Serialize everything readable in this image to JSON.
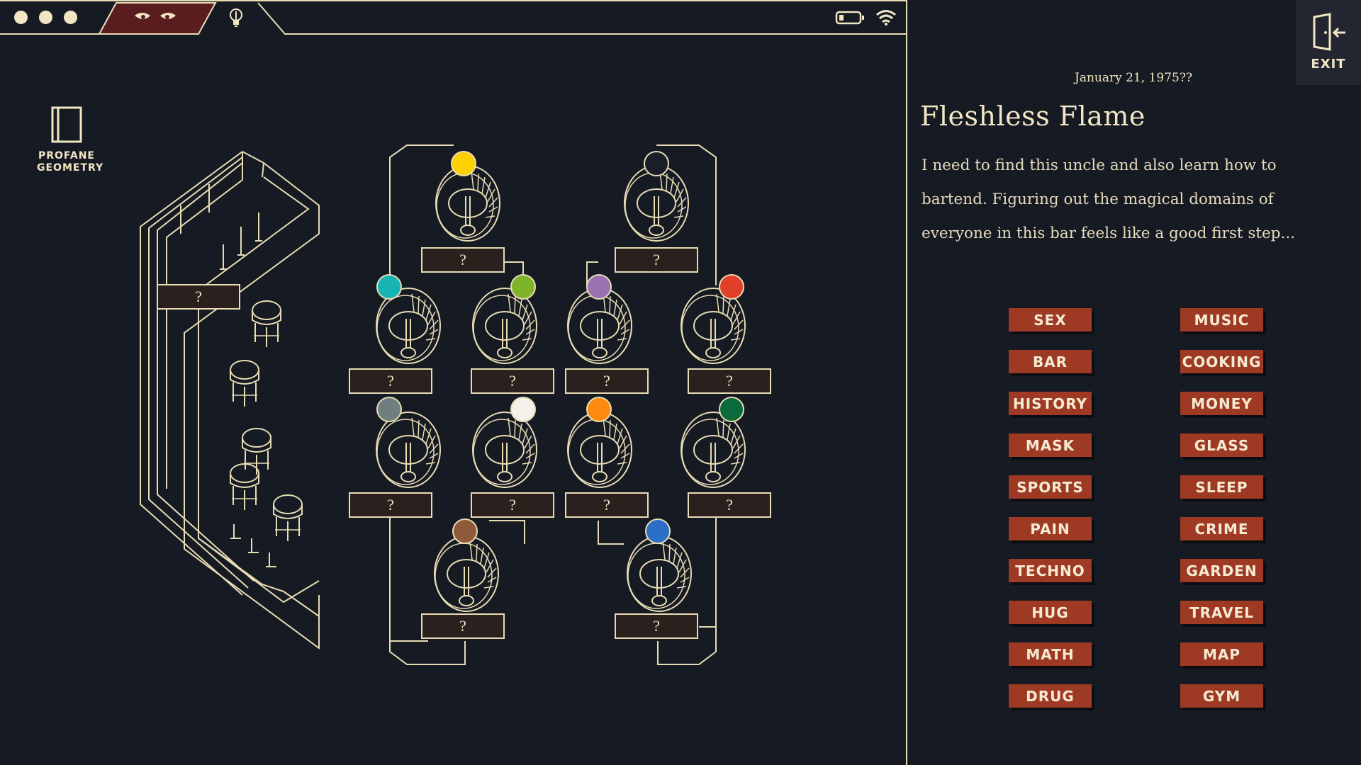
{
  "topbar": {
    "dot_icons": [
      "dot-icon",
      "dot-icon",
      "dot-icon"
    ],
    "eyes_icon": "eyes-icon",
    "hint_icon": "lightbulb-icon",
    "battery_icon": "battery-icon",
    "wifi_icon": "wifi-icon"
  },
  "book": {
    "icon": "book-icon",
    "label_line1": "PROFANE",
    "label_line2": "GEOMETRY"
  },
  "bar_slot": {
    "label": "?"
  },
  "staircases": [
    {
      "orb_color": "#ffd000",
      "slot_label": "?"
    },
    {
      "orb_color": "#1a1e28",
      "slot_label": "?"
    },
    {
      "orb_color": "#17b4b4",
      "slot_label": "?"
    },
    {
      "orb_color": "#7fb42a",
      "slot_label": "?"
    },
    {
      "orb_color": "#9a72b4",
      "slot_label": "?"
    },
    {
      "orb_color": "#e0402a",
      "slot_label": "?"
    },
    {
      "orb_color": "#6f7f80",
      "slot_label": "?"
    },
    {
      "orb_color": "#f2f1ea",
      "slot_label": "?"
    },
    {
      "orb_color": "#ff8a10",
      "slot_label": "?"
    },
    {
      "orb_color": "#0b6b3c",
      "slot_label": "?"
    },
    {
      "orb_color": "#8e5a3a",
      "slot_label": "?"
    },
    {
      "orb_color": "#2a6ec6",
      "slot_label": "?"
    }
  ],
  "panel": {
    "date": "January 21, 1975??",
    "title": "Fleshless Flame",
    "description": "I need to find this uncle and also learn how to bartend. Figuring out the magical domains of everyone in this bar feels like a good first step...",
    "exit_label": "EXIT",
    "exit_icon": "door-exit-icon"
  },
  "tags": [
    "SEX",
    "MUSIC",
    "BAR",
    "COOKING",
    "HISTORY",
    "MONEY",
    "MASK",
    "GLASS",
    "SPORTS",
    "SLEEP",
    "PAIN",
    "CRIME",
    "TECHNO",
    "GARDEN",
    "HUG",
    "TRAVEL",
    "MATH",
    "MAP",
    "DRUG",
    "GYM"
  ],
  "colors": {
    "background": "#161a23",
    "line": "#e8dcb5",
    "tag_fill": "#9e3924",
    "eyes_tab": "#5a1d1f",
    "slot_fill": "#2a211e"
  }
}
